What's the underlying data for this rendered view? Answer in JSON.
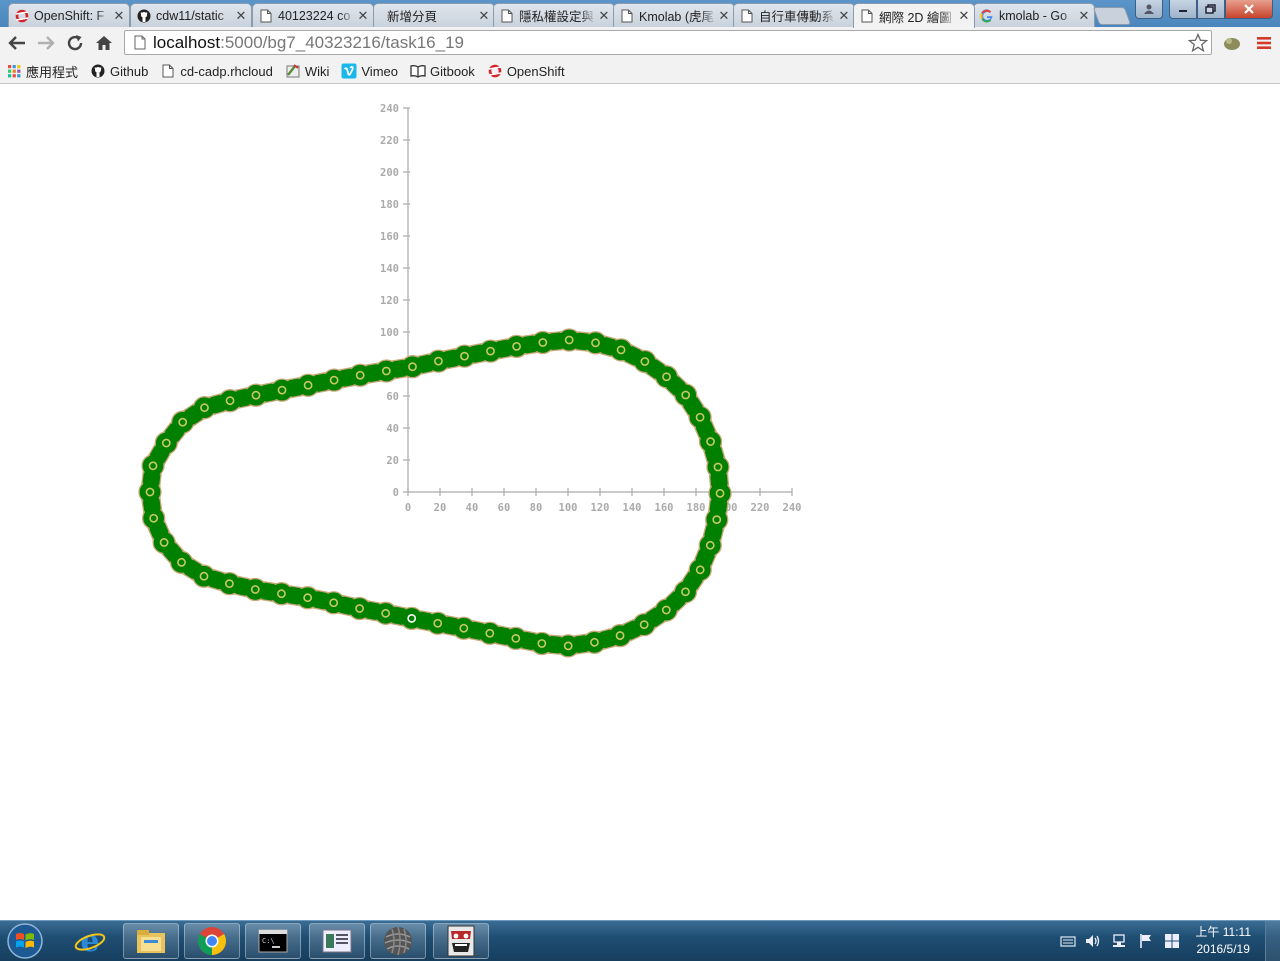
{
  "browser": {
    "tabs": [
      {
        "title": "OpenShift: F",
        "icon": "openshift-icon",
        "active": false
      },
      {
        "title": "cdw11/static",
        "icon": "github-icon",
        "active": false
      },
      {
        "title": "40123224 co",
        "icon": "page-icon",
        "active": false
      },
      {
        "title": "新增分頁",
        "icon": "",
        "active": false
      },
      {
        "title": "隱私權設定與",
        "icon": "page-icon",
        "active": false
      },
      {
        "title": "Kmolab (虎尾",
        "icon": "page-icon",
        "active": false
      },
      {
        "title": "自行車傳動系",
        "icon": "page-icon",
        "active": false
      },
      {
        "title": "網際 2D 繪圖",
        "icon": "page-icon",
        "active": true
      },
      {
        "title": "kmolab - Go",
        "icon": "google-icon",
        "active": false
      }
    ],
    "url_host": "localhost",
    "url_path": ":5000/bg7_40323216/task16_19",
    "bookmarks": [
      {
        "label": "應用程式",
        "icon": "apps-grid-icon"
      },
      {
        "label": "Github",
        "icon": "github-icon"
      },
      {
        "label": "cd-cadp.rhcloud",
        "icon": "page-icon"
      },
      {
        "label": "Wiki",
        "icon": "wiki-icon"
      },
      {
        "label": "Vimeo",
        "icon": "vimeo-icon"
      },
      {
        "label": "Gitbook",
        "icon": "book-icon"
      },
      {
        "label": "OpenShift",
        "icon": "openshift-icon"
      }
    ]
  },
  "drawing": {
    "x_ticks": [
      0,
      20,
      40,
      60,
      80,
      100,
      120,
      140,
      160,
      180,
      200,
      220,
      240
    ],
    "y_ticks": [
      0,
      20,
      40,
      60,
      80,
      100,
      120,
      140,
      160,
      180,
      200,
      220,
      240
    ],
    "chain": {
      "shape": "closed loop of chain links around two sprockets",
      "link_color": "#008000",
      "outline_color": "#c8a878",
      "pin_color": "#c8c864",
      "link_count": 54
    }
  },
  "taskbar": {
    "apps": [
      "ie-icon",
      "explorer-icon",
      "chrome-icon",
      "cmd-icon",
      "editor-icon",
      "sphere-app-icon",
      "mask-app-icon"
    ],
    "clock_time": "上午 11:11",
    "clock_date": "2016/5/19"
  }
}
